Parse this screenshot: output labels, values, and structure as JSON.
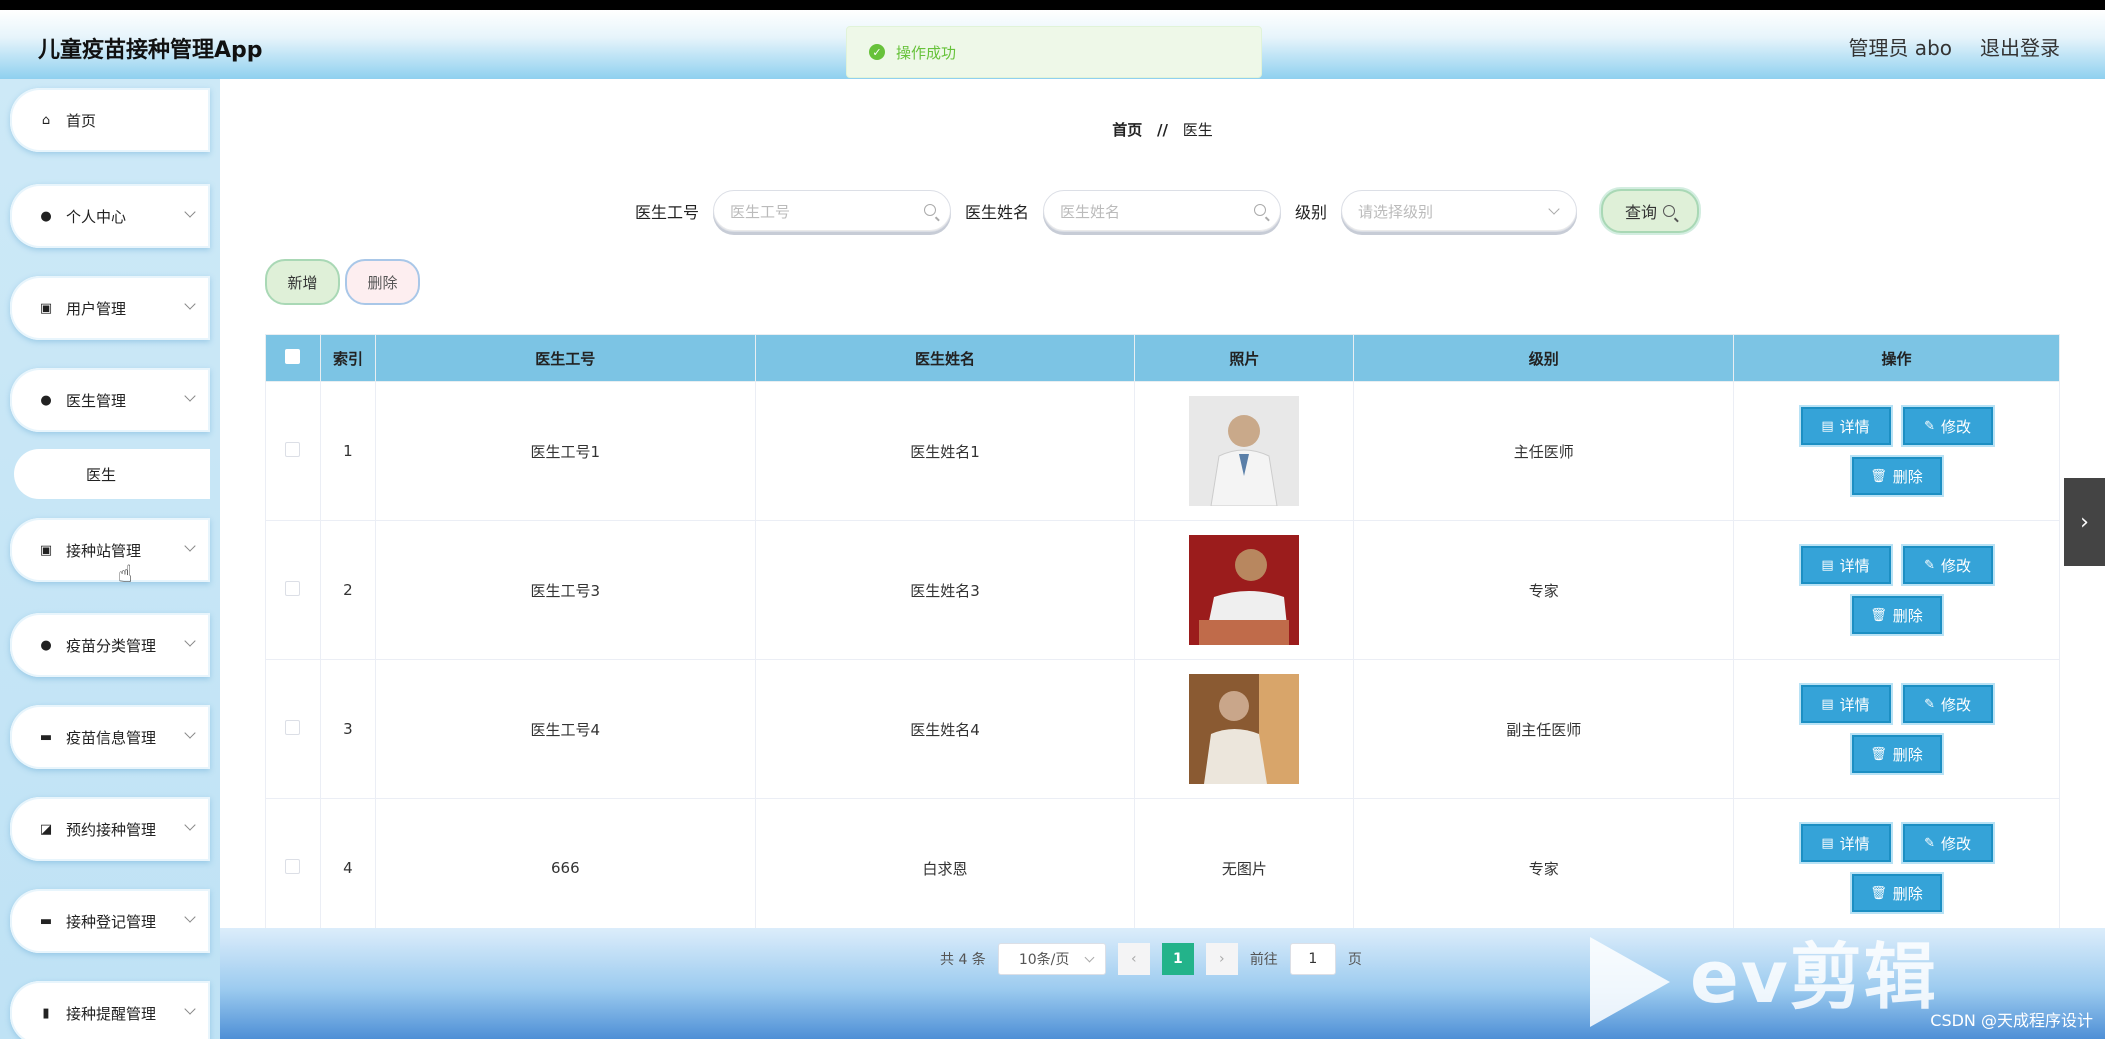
{
  "app": {
    "title": "儿童疫苗接种管理App"
  },
  "header": {
    "user_label": "管理员 abo",
    "logout_label": "退出登录"
  },
  "toast": {
    "message": "操作成功"
  },
  "sidebar": {
    "items": [
      {
        "label": "首页",
        "icon": "home-icon"
      },
      {
        "label": "个人中心",
        "icon": "user-icon"
      },
      {
        "label": "用户管理",
        "icon": "clipboard-icon"
      },
      {
        "label": "医生管理",
        "icon": "bulb-icon"
      },
      {
        "label": "接种站管理",
        "icon": "checklist-icon"
      },
      {
        "label": "疫苗分类管理",
        "icon": "user-icon"
      },
      {
        "label": "疫苗信息管理",
        "icon": "wallet-icon"
      },
      {
        "label": "预约接种管理",
        "icon": "chart-icon"
      },
      {
        "label": "接种登记管理",
        "icon": "monitor-icon"
      },
      {
        "label": "接种提醒管理",
        "icon": "bar-chart-icon"
      }
    ],
    "sub_item": "医生"
  },
  "breadcrumb": {
    "home": "首页",
    "sep": "//",
    "current": "医生"
  },
  "search": {
    "field1_label": "医生工号",
    "field1_placeholder": "医生工号",
    "field2_label": "医生姓名",
    "field2_placeholder": "医生姓名",
    "field3_label": "级别",
    "field3_placeholder": "请选择级别",
    "query_label": "查询"
  },
  "actions": {
    "add_label": "新增",
    "delete_label": "删除"
  },
  "table": {
    "headers": [
      "索引",
      "医生工号",
      "医生姓名",
      "照片",
      "级别",
      "操作"
    ],
    "rows": [
      {
        "index": "1",
        "doctor_id": "医生工号1",
        "doctor_name": "医生姓名1",
        "photo": "",
        "level": "主任医师"
      },
      {
        "index": "2",
        "doctor_id": "医生工号3",
        "doctor_name": "医生姓名3",
        "photo": "",
        "level": "专家"
      },
      {
        "index": "3",
        "doctor_id": "医生工号4",
        "doctor_name": "医生姓名4",
        "photo": "",
        "level": "副主任医师"
      },
      {
        "index": "4",
        "doctor_id": "666",
        "doctor_name": "白求恩",
        "photo": "无图片",
        "level": "专家"
      }
    ],
    "op_detail": "详情",
    "op_edit": "修改",
    "op_delete": "删除"
  },
  "pager": {
    "total_label": "共 4 条",
    "page_size": "10条/页",
    "current_page": "1",
    "goto_label": "前往",
    "goto_value": "1",
    "page_unit": "页"
  },
  "watermark": {
    "text": "ev剪辑",
    "credit": "CSDN @天成程序设计"
  }
}
